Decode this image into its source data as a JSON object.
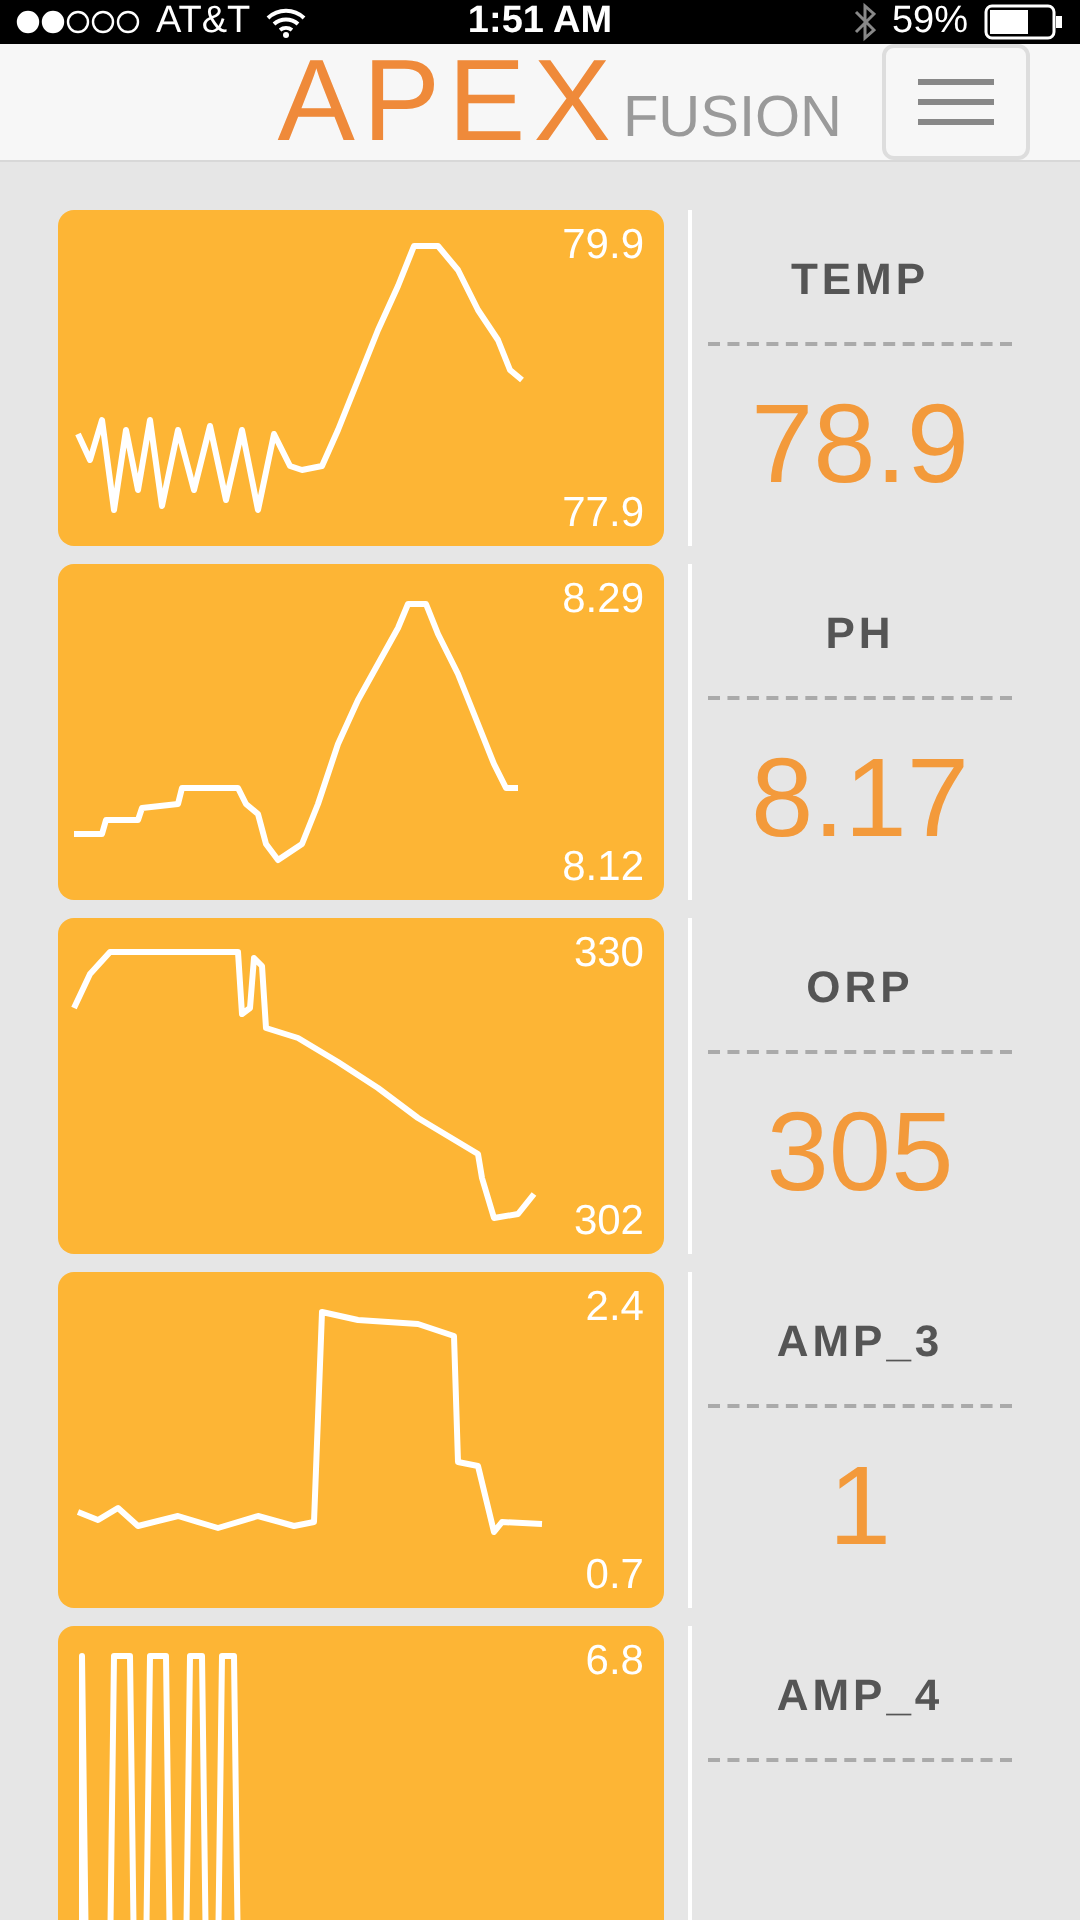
{
  "status_bar": {
    "carrier": "AT&T",
    "time": "1:51 AM",
    "battery": "59%"
  },
  "header": {
    "logo": "APEX",
    "logo_suffix": "FUSION"
  },
  "metrics": [
    {
      "name": "TEMP",
      "value": "78.9",
      "max": "79.9",
      "min": "77.9"
    },
    {
      "name": "PH",
      "value": "8.17",
      "max": "8.29",
      "min": "8.12"
    },
    {
      "name": "ORP",
      "value": "305",
      "max": "330",
      "min": "302"
    },
    {
      "name": "AMP_3",
      "value": "1",
      "max": "2.4",
      "min": "0.7"
    },
    {
      "name": "AMP_4",
      "max": "6.8"
    }
  ]
}
